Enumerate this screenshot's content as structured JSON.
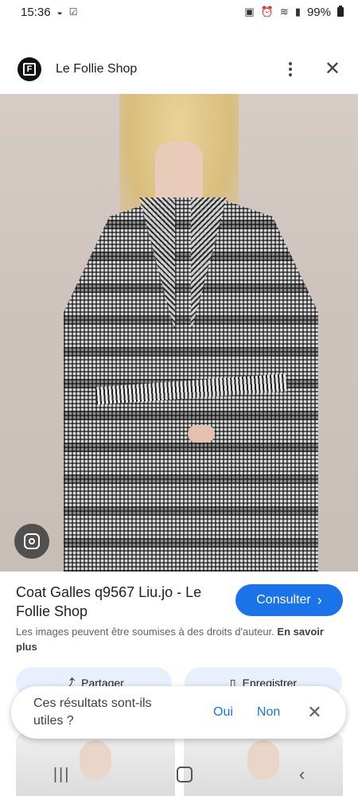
{
  "status_bar": {
    "time": "15:36",
    "left_icons": [
      "notification-icon",
      "check-icon"
    ],
    "right_icons": [
      "battery-saver-icon",
      "alarm-icon",
      "wifi-icon",
      "signal-icon"
    ],
    "battery": "99%"
  },
  "header": {
    "logo_letter": "F",
    "title": "Le Follie Shop",
    "more_icon": "more-vert-icon",
    "close_icon": "close-icon"
  },
  "product": {
    "title": "Coat Galles q9567 Liu.jo - Le Follie Shop",
    "consult_label": "Consulter",
    "copyright_text": "Les images peuvent être soumises à des droits d'auteur.",
    "learn_more": "En savoir plus"
  },
  "chips": {
    "share_label": "Partager",
    "save_label": "Enregistrer"
  },
  "feedback": {
    "question": "Ces résultats sont-ils utiles ?",
    "yes": "Oui",
    "no": "Non"
  },
  "colors": {
    "accent": "#1a73e8",
    "chip_bg": "#e8f0fe"
  }
}
